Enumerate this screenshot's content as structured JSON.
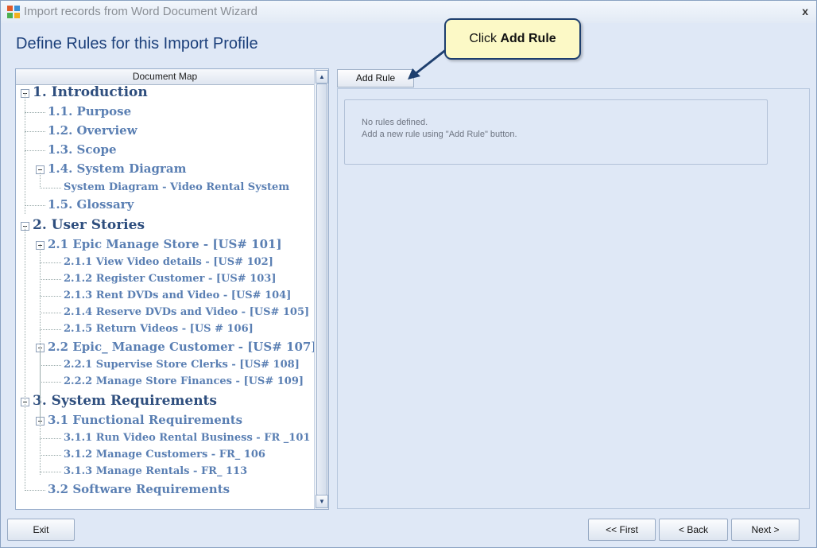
{
  "window": {
    "title": "Import records from Word Document Wizard",
    "close_glyph": "x"
  },
  "heading": "Define Rules for this Import Profile",
  "document_map": {
    "header": "Document Map",
    "items": [
      {
        "label": "1. Introduction",
        "level": 1,
        "toggle": true
      },
      {
        "label": "1.1. Purpose",
        "level": 2,
        "toggle": false
      },
      {
        "label": "1.2. Overview",
        "level": 2,
        "toggle": false
      },
      {
        "label": "1.3. Scope",
        "level": 2,
        "toggle": false
      },
      {
        "label": "1.4. System Diagram",
        "level": 2,
        "toggle": true
      },
      {
        "label": "System Diagram - Video Rental System",
        "level": 3,
        "toggle": false
      },
      {
        "label": "1.5. Glossary",
        "level": 2,
        "toggle": false
      },
      {
        "label": "2. User Stories",
        "level": 1,
        "toggle": true
      },
      {
        "label": "2.1 Epic Manage Store - [US# 101]",
        "level": 2,
        "toggle": true
      },
      {
        "label": "2.1.1 View Video details - [US# 102]",
        "level": 3,
        "toggle": false
      },
      {
        "label": "2.1.2 Register Customer - [US# 103]",
        "level": 3,
        "toggle": false
      },
      {
        "label": "2.1.3 Rent DVDs and Video - [US# 104]",
        "level": 3,
        "toggle": false
      },
      {
        "label": "2.1.4 Reserve DVDs and Video - [US# 105]",
        "level": 3,
        "toggle": false
      },
      {
        "label": "2.1.5 Return Videos - [US # 106]",
        "level": 3,
        "toggle": false
      },
      {
        "label": "2.2 Epic_ Manage Customer - [US# 107]",
        "level": 2,
        "toggle": true
      },
      {
        "label": "2.2.1 Supervise Store Clerks - [US# 108]",
        "level": 3,
        "toggle": false
      },
      {
        "label": "2.2.2 Manage Store Finances - [US# 109]",
        "level": 3,
        "toggle": false
      },
      {
        "label": "3. System Requirements",
        "level": 1,
        "toggle": true
      },
      {
        "label": "3.1 Functional Requirements",
        "level": 2,
        "toggle": true
      },
      {
        "label": "3.1.1 Run Video Rental Business - FR _101",
        "level": 3,
        "toggle": false
      },
      {
        "label": "3.1.2 Manage Customers - FR_ 106",
        "level": 3,
        "toggle": false
      },
      {
        "label": "3.1.3 Manage Rentals -  FR_ 113",
        "level": 3,
        "toggle": false
      },
      {
        "label": "3.2 Software Requirements",
        "level": 2,
        "toggle": false
      }
    ]
  },
  "scrollbar": {
    "up_glyph": "▲",
    "down_glyph": "▼"
  },
  "rules": {
    "add_rule_label": "Add Rule",
    "empty_line1": "No rules defined.",
    "empty_line2": "Add a new rule using \"Add Rule\" button."
  },
  "callout": {
    "prefix": "Click ",
    "emphasis": "Add Rule"
  },
  "footer": {
    "exit_label": "Exit",
    "first_label": "<< First",
    "back_label": "< Back",
    "next_label": "Next >"
  }
}
